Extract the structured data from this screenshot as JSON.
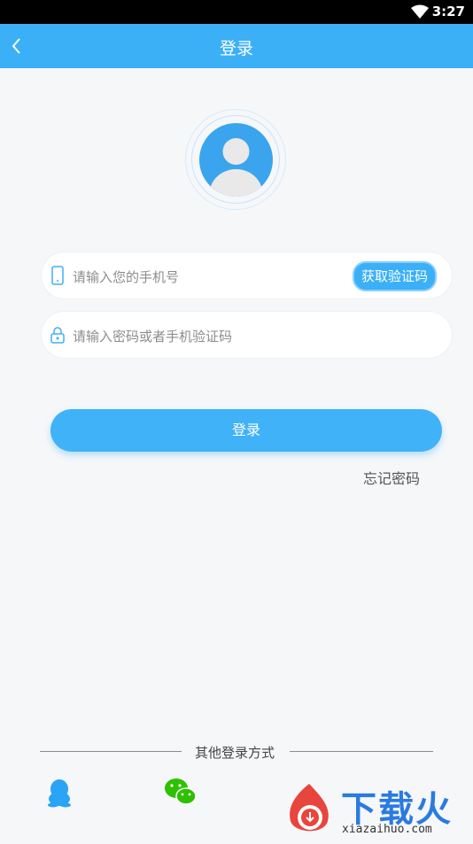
{
  "status_bar": {
    "time": "3:27",
    "wifi_icon": "wifi-icon"
  },
  "header": {
    "title": "登录",
    "back_icon": "chevron-left-icon"
  },
  "avatar": {
    "icon": "user-avatar-icon"
  },
  "phone_field": {
    "placeholder": "请输入您的手机号",
    "icon": "phone-icon"
  },
  "code_button": {
    "label": "获取验证码"
  },
  "password_field": {
    "placeholder": "请输入密码或者手机验证码",
    "icon": "lock-icon"
  },
  "login_button": {
    "label": "登录"
  },
  "forgot_link": {
    "label": "忘记密码"
  },
  "other_login": {
    "label": "其他登录方式",
    "options": [
      {
        "icon": "qq-icon",
        "color": "#2aa4f4"
      },
      {
        "icon": "wechat-icon",
        "color": "#2dc100"
      }
    ]
  },
  "watermark": {
    "text": "下载火",
    "url": "xiazaihuo.com"
  },
  "colors": {
    "accent": "#3bb0f7",
    "background": "#f6f7f9"
  }
}
